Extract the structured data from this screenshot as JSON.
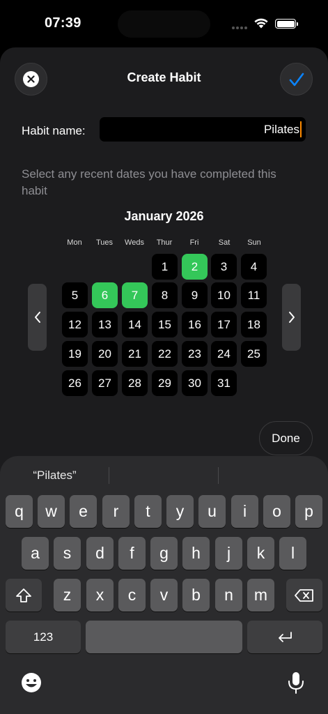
{
  "status_bar": {
    "time": "07:39"
  },
  "sheet": {
    "title": "Create Habit",
    "close_icon": "xmark-circle-icon",
    "confirm_icon": "checkmark-icon",
    "habit_name_label": "Habit name:",
    "habit_name_value": "Pilates",
    "hint": "Select any recent dates you have completed this habit",
    "done_label": "Done"
  },
  "calendar": {
    "month_title": "January 2026",
    "weekdays": [
      "Mon",
      "Tues",
      "Weds",
      "Thur",
      "Fri",
      "Sat",
      "Sun"
    ],
    "days": [
      "1",
      "2",
      "3",
      "4",
      "5",
      "6",
      "7",
      "8",
      "9",
      "10",
      "11",
      "12",
      "13",
      "14",
      "15",
      "16",
      "17",
      "18",
      "19",
      "20",
      "21",
      "22",
      "23",
      "24",
      "25",
      "26",
      "27",
      "28",
      "29",
      "30",
      "31"
    ],
    "first_weekday_index": 3,
    "selected_days": [
      2,
      6,
      7
    ],
    "selected_color": "#34c759",
    "prev_icon": "chevron-left-icon",
    "next_icon": "chevron-right-icon"
  },
  "keyboard": {
    "suggestions": [
      "“Pilates”",
      "",
      ""
    ],
    "row1": [
      "q",
      "w",
      "e",
      "r",
      "t",
      "y",
      "u",
      "i",
      "o",
      "p"
    ],
    "row2": [
      "a",
      "s",
      "d",
      "f",
      "g",
      "h",
      "j",
      "k",
      "l"
    ],
    "row3": [
      "z",
      "x",
      "c",
      "v",
      "b",
      "n",
      "m"
    ],
    "numbers_label": "123",
    "shift_icon": "shift-icon",
    "delete_icon": "delete-backward-icon",
    "return_icon": "return-icon",
    "emoji_icon": "emoji-icon",
    "mic_icon": "microphone-icon"
  },
  "colors": {
    "accent": "#0a84ff",
    "selected": "#34c759",
    "cursor": "#ff8a00"
  }
}
